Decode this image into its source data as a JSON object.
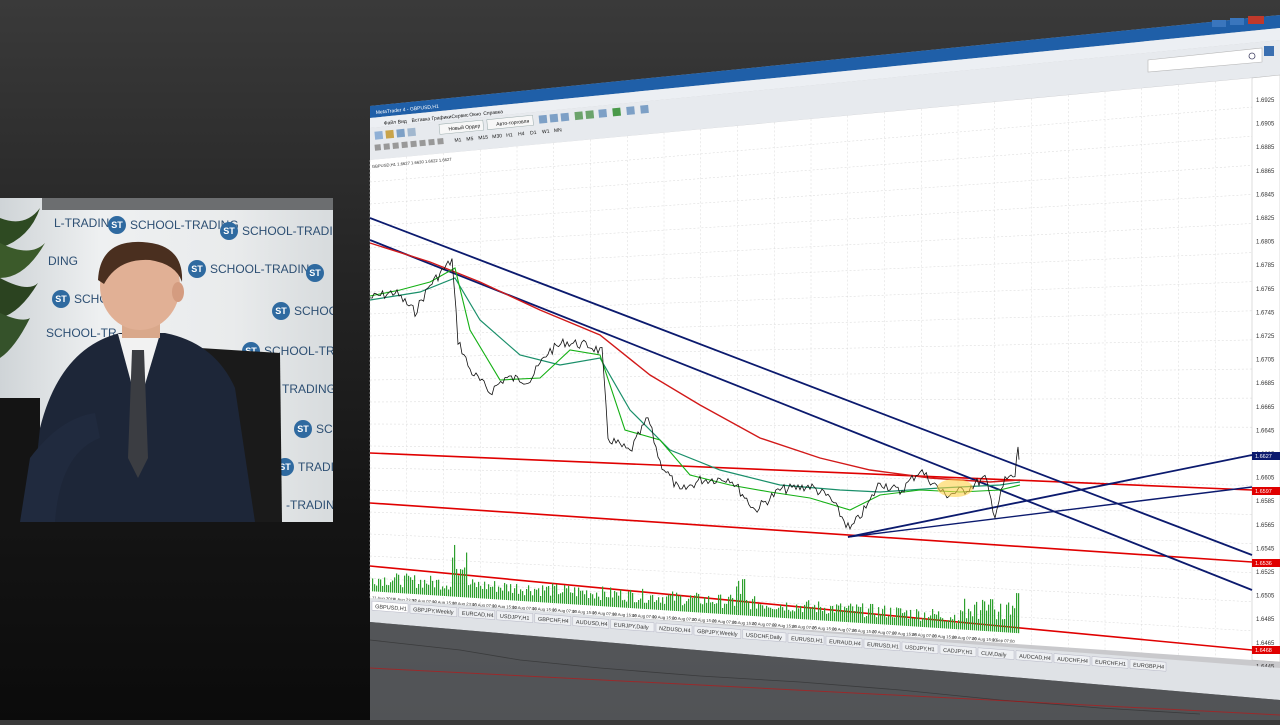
{
  "app": {
    "title": "MetaTrader 4 - GBPUSD,H1",
    "window_controls": [
      "minimize",
      "maximize",
      "close"
    ]
  },
  "menu": {
    "items": [
      "Файл",
      "Вид",
      "Вставка",
      "Графики",
      "Сервис",
      "Окно",
      "Справка"
    ]
  },
  "toolbar": {
    "new_order_label": "Новый Ордер",
    "autotrading_label": "Авто-торговля",
    "timeframes": [
      "M1",
      "M5",
      "M15",
      "M30",
      "H1",
      "H4",
      "D1",
      "W1",
      "MN"
    ]
  },
  "chart": {
    "symbol_info": "GBPUSD,H1  1.6627 1.6630 1.6622 1.6627",
    "current_price": "1.6627",
    "red_level_1": "1.6597",
    "red_level_2": "1.6536",
    "red_level_3": "1.6468",
    "price_ticks": [
      "1.6925",
      "1.6905",
      "1.6885",
      "1.6865",
      "1.6845",
      "1.6825",
      "1.6805",
      "1.6785",
      "1.6765",
      "1.6745",
      "1.6725",
      "1.6705",
      "1.6685",
      "1.6665",
      "1.6645",
      "1.6625",
      "1.6605",
      "1.6585",
      "1.6565",
      "1.6545",
      "1.6525",
      "1.6505",
      "1.6485",
      "1.6465",
      "1.6445"
    ],
    "date_ticks": [
      "11 Aug 2014",
      "11 Aug 23:00",
      "12 Aug 07:00",
      "12 Aug 15:00",
      "12 Aug 23:00",
      "13 Aug 07:00",
      "13 Aug 15:00",
      "14 Aug 07:00",
      "14 Aug 15:00",
      "15 Aug 07:00",
      "15 Aug 15:00",
      "18 Aug 07:00",
      "18 Aug 15:00",
      "19 Aug 07:00",
      "19 Aug 15:00",
      "20 Aug 07:00",
      "20 Aug 15:00",
      "21 Aug 07:00",
      "21 Aug 15:00",
      "22 Aug 07:00",
      "22 Aug 15:00",
      "25 Aug 07:00",
      "25 Aug 15:00",
      "26 Aug 07:00",
      "26 Aug 15:00",
      "27 Aug 07:00",
      "27 Aug 15:00",
      "28 Aug 07:00",
      "28 Aug 15:00",
      "29 Aug 07:00",
      "29 Aug 15:00",
      "1 Sep 07:00"
    ]
  },
  "tabs": [
    "GBPUSD,H1",
    "GBPJPY,Weekly",
    "EURCAD,H4",
    "USDJPY,H1",
    "GBPCHF,H4",
    "AUDUSD,H4",
    "EURJPY,Daily",
    "NZDUSD,H4",
    "GBPJPY,Weekly",
    "USDCHF,Daily",
    "EURUSD,H1",
    "EURAUD,H4",
    "EURUSD,H1",
    "USDJPY,H1",
    "CADJPY,H1",
    "CLM,Daily",
    "AUDCAD,H4",
    "AUDCHF,H4",
    "EURCHF,H1",
    "EURGBP,H4"
  ],
  "webcam": {
    "logo_text": "SCHOOL-TRADING",
    "logo_badge": "ST",
    "partial_texts": [
      "L-TRADING",
      "DING",
      "SCHOOL-TR",
      "TRADING",
      "TRADING",
      "-TRADING",
      "SCHOO",
      "SC"
    ]
  },
  "colors": {
    "titlebar": "#1f5fa8",
    "red_line": "#e00000",
    "navy_line": "#0b1a6e",
    "green_ma": "#00a000",
    "teal_ma": "#1a8f6a",
    "red_ma": "#d21919",
    "price": "#101010"
  }
}
